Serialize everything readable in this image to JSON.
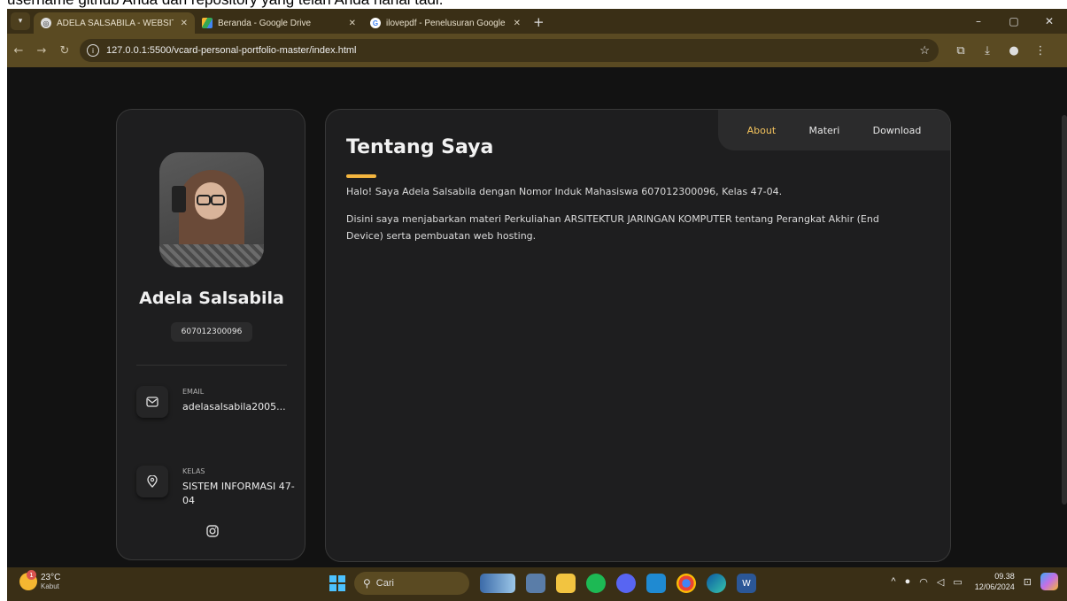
{
  "top_caption": "username github Anda dan repository yang telah Anda hanai tadi.",
  "browser": {
    "tabs": [
      {
        "title": "ADELA SALSABILA - WEBSITE H",
        "close": "✕",
        "active": true
      },
      {
        "title": "Beranda - Google Drive",
        "close": "✕",
        "active": false
      },
      {
        "title": "ilovepdf - Penelusuran Google",
        "close": "✕",
        "active": false
      }
    ],
    "new_tab": "+",
    "url": "127.0.0.1:5500/vcard-personal-portfolio-master/index.html",
    "window_controls": {
      "minimize": "–",
      "maximize": "▢",
      "close": "✕"
    }
  },
  "sidebar": {
    "name": "Adela Salsabila",
    "id_number": "607012300096",
    "contacts": [
      {
        "label": "EMAIL",
        "value": "adelasalsabila2005..."
      },
      {
        "label": "KELAS",
        "value": "SISTEM INFORMASI 47-04"
      }
    ]
  },
  "navbar": {
    "items": [
      {
        "label": "About",
        "active": true
      },
      {
        "label": "Materi",
        "active": false
      },
      {
        "label": "Download",
        "active": false
      }
    ]
  },
  "article": {
    "title": "Tentang Saya",
    "paragraphs": [
      "Halo! Saya Adela Salsabila dengan Nomor Induk Mahasiswa 607012300096, Kelas 47-04.",
      "Disini saya menjabarkan materi Perkuliahan ARSITEKTUR JARINGAN KOMPUTER tentang Perangkat Akhir (End Device) serta pembuatan web hosting."
    ]
  },
  "taskbar": {
    "weather": {
      "temp": "23°C",
      "condition": "Kabut",
      "badge": "1"
    },
    "search_placeholder": "Cari",
    "clock": {
      "time": "09.38",
      "date": "12/06/2024"
    }
  },
  "colors": {
    "accent": "#f4c35d",
    "background": "#121212",
    "card": "#1e1e1f"
  }
}
